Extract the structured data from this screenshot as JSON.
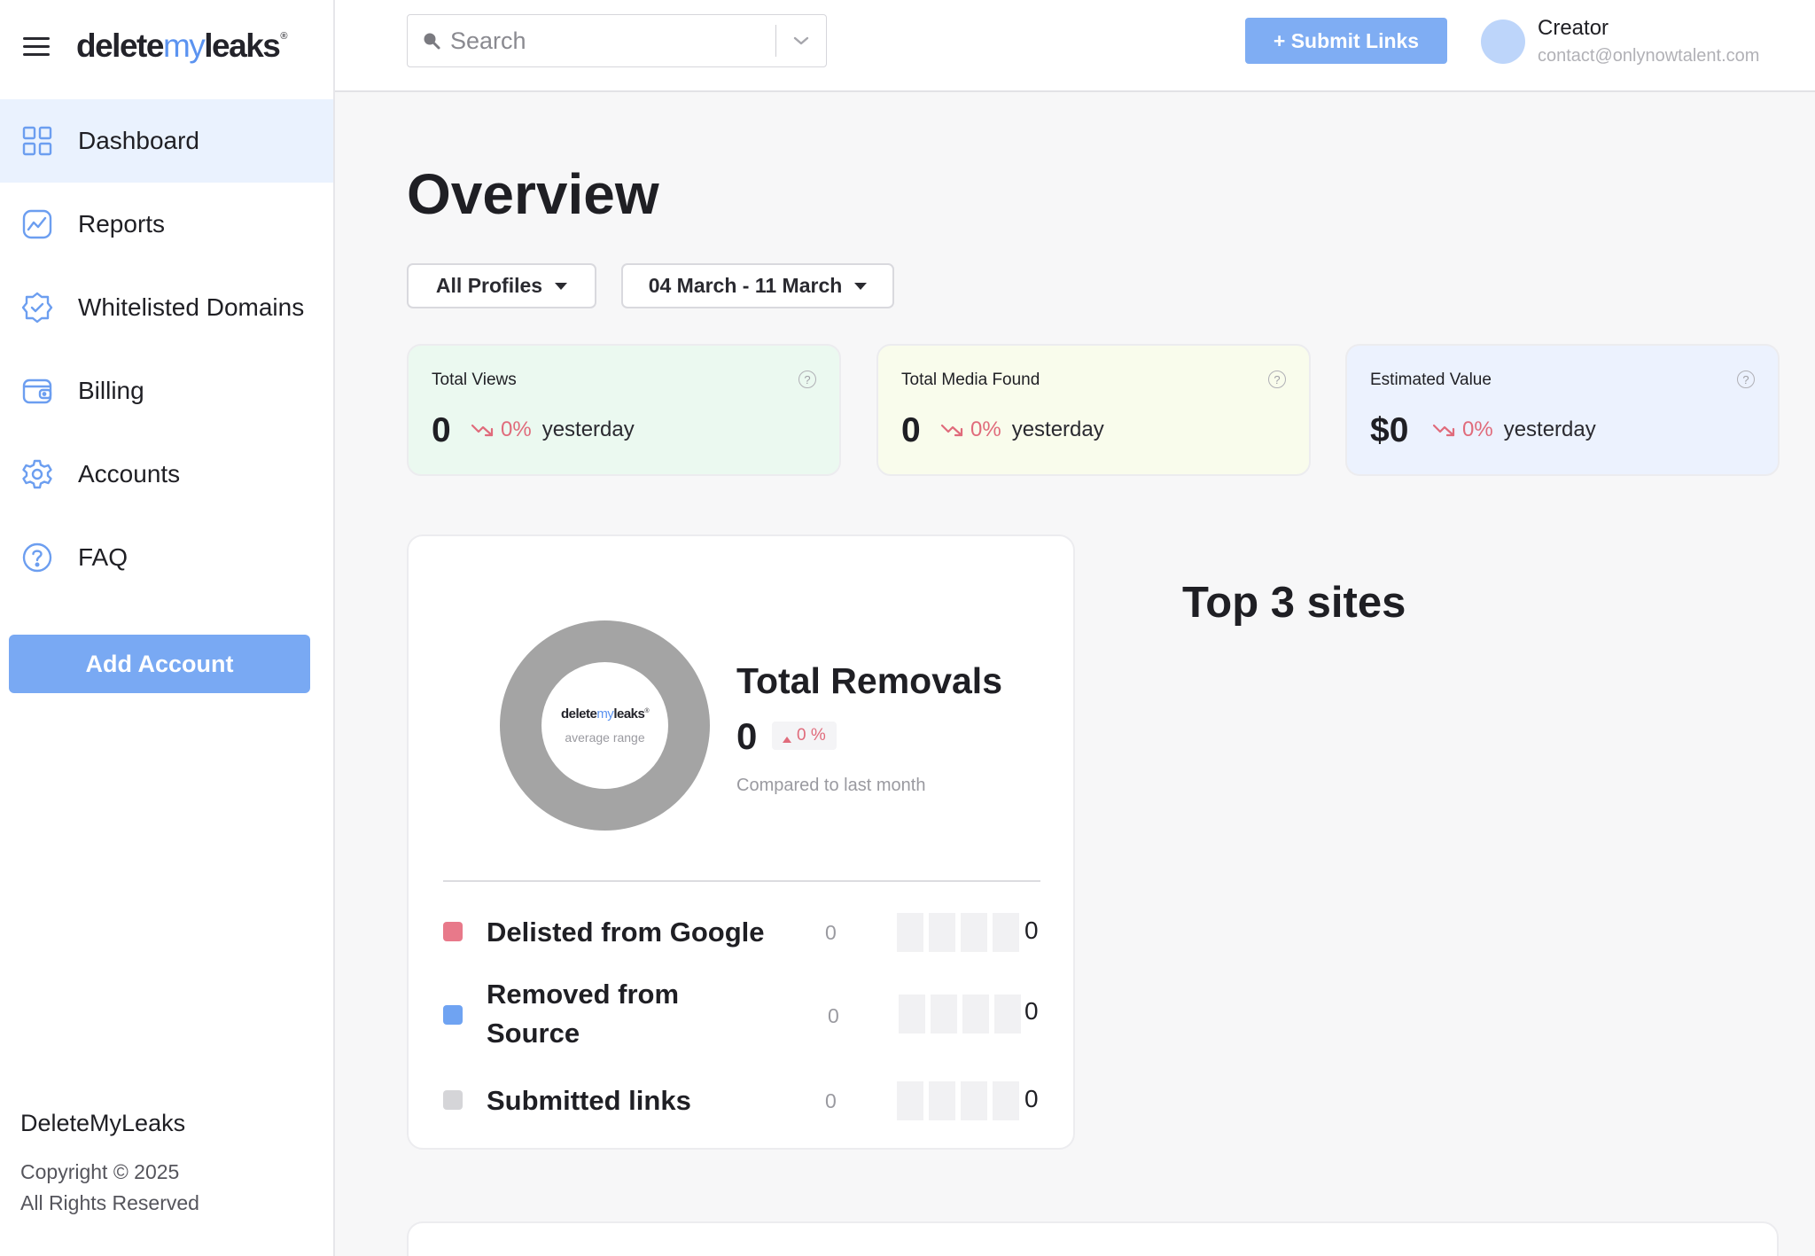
{
  "brand": {
    "logo_a": "delete",
    "logo_b": "my",
    "logo_c": "leaks",
    "logo_mark": "®",
    "accent": "#5b93f0"
  },
  "sidebar": {
    "items": [
      {
        "label": "Dashboard",
        "icon": "grid-icon",
        "active": true
      },
      {
        "label": "Reports",
        "icon": "chart-icon"
      },
      {
        "label": "Whitelisted Domains",
        "icon": "badge-check-icon"
      },
      {
        "label": "Billing",
        "icon": "wallet-icon"
      },
      {
        "label": "Accounts",
        "icon": "gear-icon"
      },
      {
        "label": "FAQ",
        "icon": "question-icon"
      }
    ],
    "add_account": "Add Account",
    "footer_name": "DeleteMyLeaks",
    "footer_copyright": "Copyright © 2025",
    "footer_rights": "All Rights Reserved"
  },
  "header": {
    "search_placeholder": "Search",
    "submit_label": "+ Submit Links",
    "user_role": "Creator",
    "user_email": "contact@onlynowtalent.com"
  },
  "main": {
    "title": "Overview",
    "filters": {
      "profiles": "All Profiles",
      "dates": "04 March - 11 March"
    },
    "stats": [
      {
        "label": "Total Views",
        "value": "0",
        "change": "0%",
        "suffix": "yesterday",
        "bg": "#ebf9f0"
      },
      {
        "label": "Total Media Found",
        "value": "0",
        "change": "0%",
        "suffix": "yesterday",
        "bg": "#f9fcec"
      },
      {
        "label": "Estimated Value",
        "value": "$0",
        "change": "0%",
        "suffix": "yesterday",
        "bg": "#ecf2fe"
      }
    ],
    "removals": {
      "donut_logo_a": "delete",
      "donut_logo_b": "my",
      "donut_logo_c": "leaks",
      "donut_logo_mark": "®",
      "donut_caption": "average range",
      "title": "Total Removals",
      "value": "0",
      "change": "0 %",
      "compare": "Compared to last month",
      "rows": [
        {
          "label": "Delisted from Google",
          "value": "0",
          "count": "0",
          "color": "#e8798a"
        },
        {
          "label": "Removed from Source",
          "value": "0",
          "count": "0",
          "color": "#6fa3f2"
        },
        {
          "label": "Submitted links",
          "value": "0",
          "count": "0",
          "color": "#d5d5d8"
        }
      ]
    },
    "top_sites_title": "Top 3 sites"
  }
}
